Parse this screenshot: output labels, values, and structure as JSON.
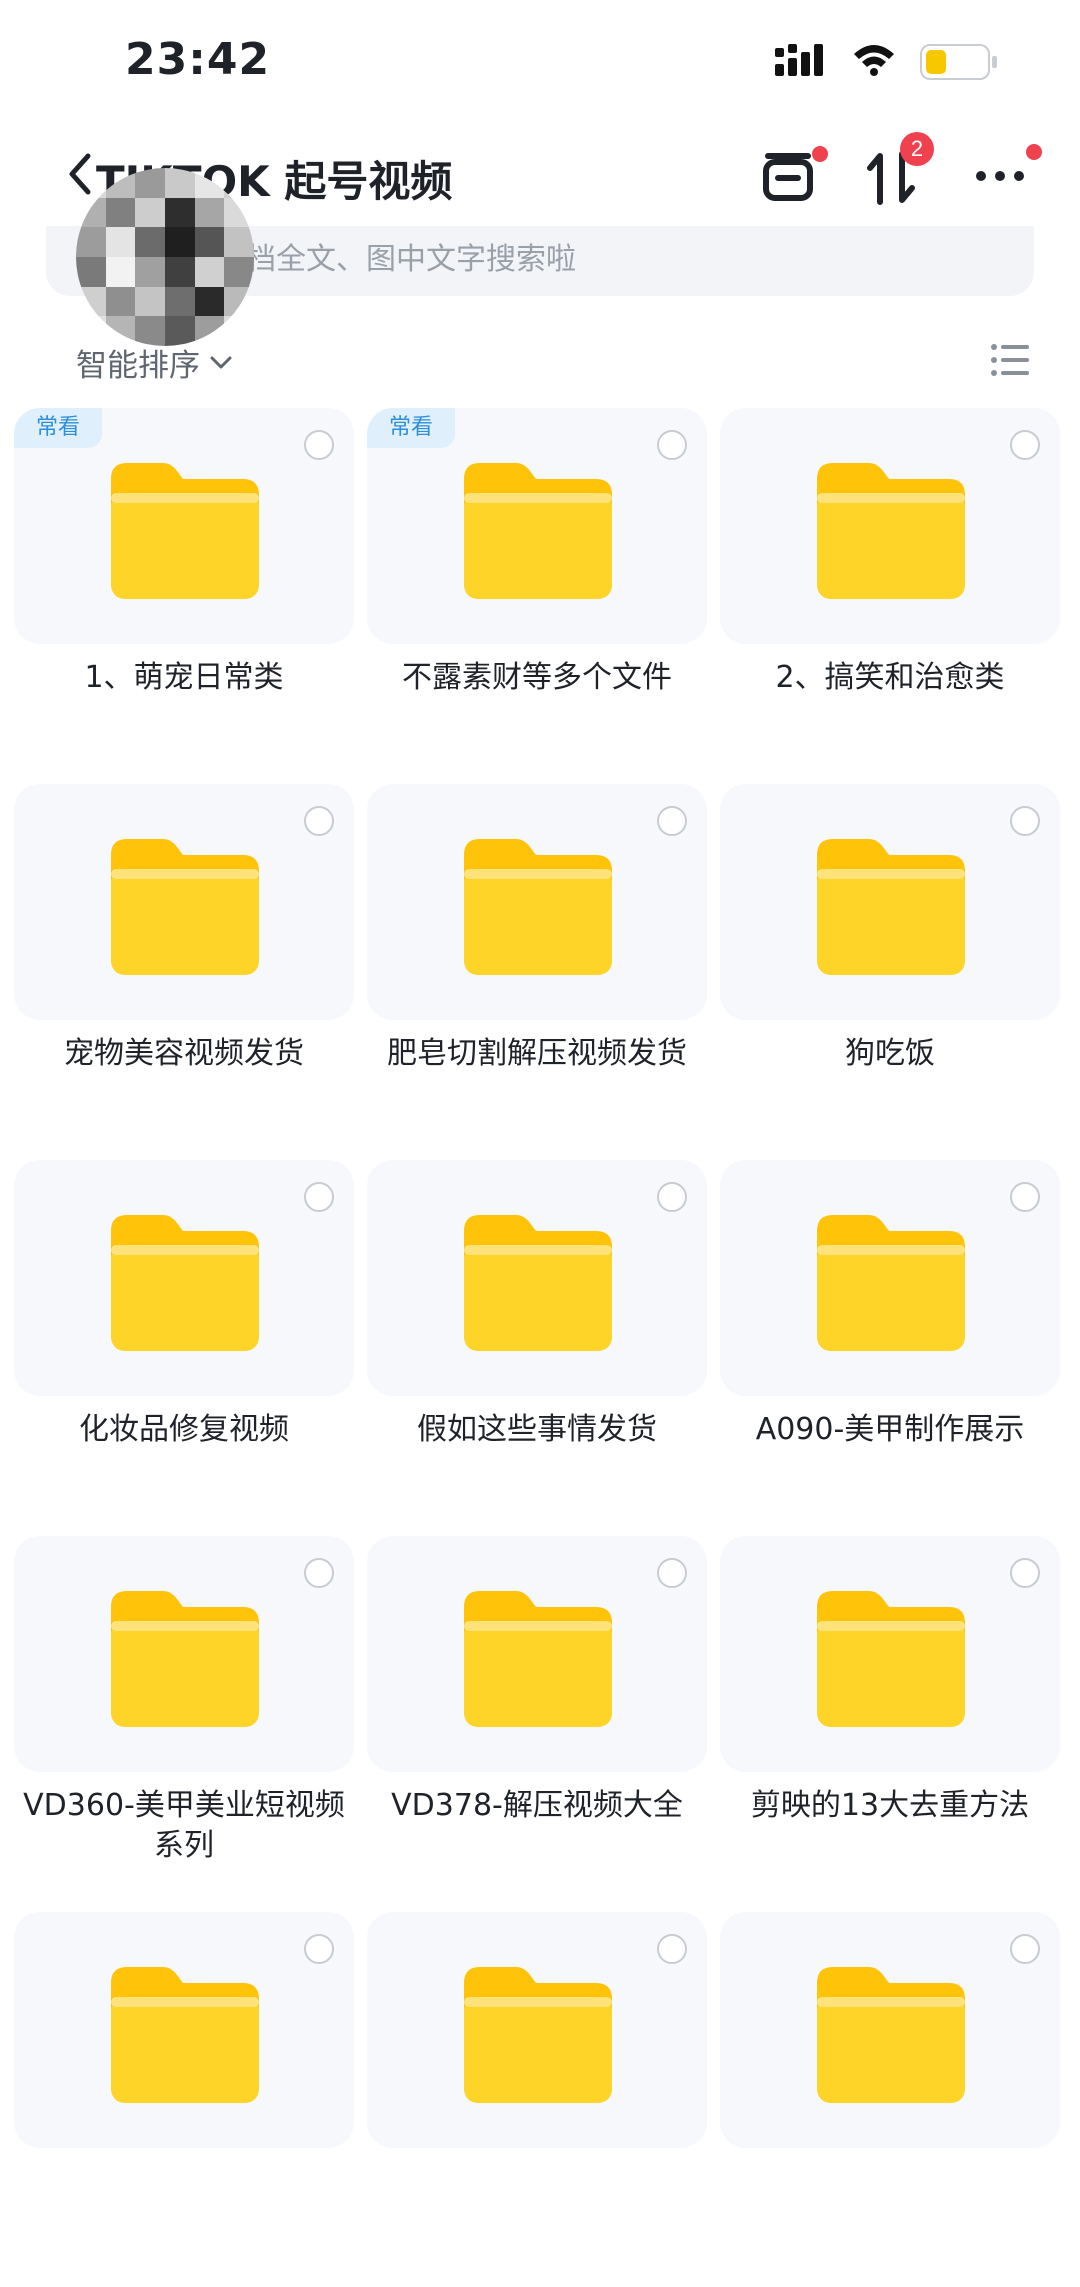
{
  "status_bar": {
    "time": "23:42",
    "battery_color": "#f7c800"
  },
  "header": {
    "title": "TIKTOK 起号视频",
    "transfer_badge": "2",
    "icons": [
      "back-icon",
      "cloud-box-icon",
      "transfer-icon",
      "more-icon"
    ]
  },
  "search": {
    "placeholder": "档全文、图中文字搜索啦"
  },
  "sort": {
    "label": "智能排序"
  },
  "folders": [
    {
      "name": "1、萌宠日常类",
      "tag": "常看"
    },
    {
      "name": "不露素财等多个文件",
      "tag": "常看"
    },
    {
      "name": "2、搞笑和治愈类",
      "tag": ""
    },
    {
      "name": "宠物美容视频发货",
      "tag": ""
    },
    {
      "name": "肥皂切割解压视频发货",
      "tag": ""
    },
    {
      "name": "狗吃饭",
      "tag": ""
    },
    {
      "name": "化妆品修复视频",
      "tag": ""
    },
    {
      "name": "假如这些事情发货",
      "tag": ""
    },
    {
      "name": "A090-美甲制作展示",
      "tag": ""
    },
    {
      "name": "VD360-美甲美业短视频系列",
      "tag": ""
    },
    {
      "name": "VD378-解压视频大全",
      "tag": ""
    },
    {
      "name": "剪映的13大去重方法",
      "tag": ""
    },
    {
      "name": "",
      "tag": ""
    },
    {
      "name": "",
      "tag": ""
    },
    {
      "name": "",
      "tag": ""
    }
  ],
  "colors": {
    "accent_red": "#f0414f",
    "folder_yellow": "#ffd21f",
    "tag_blue": "#2f8fd6"
  }
}
